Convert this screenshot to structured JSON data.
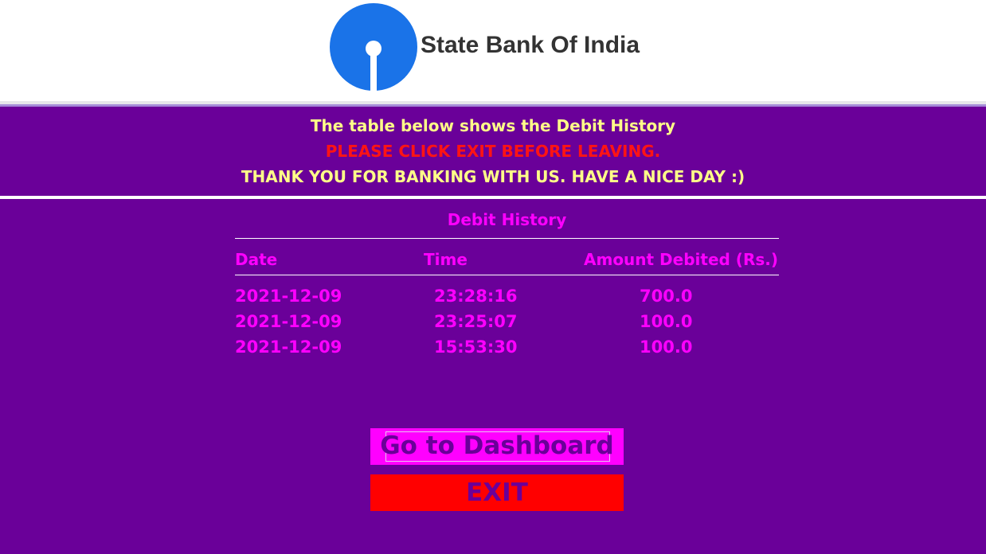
{
  "header": {
    "bank_name": "State Bank Of India",
    "logo_icon": "sbi-logo-icon",
    "logo_color": "#1a73e8"
  },
  "messages": {
    "info": "The table below shows the Debit History",
    "warning": "PLEASE CLICK EXIT BEFORE LEAVING.",
    "thanks": "THANK YOU FOR BANKING WITH US. HAVE A NICE DAY :)"
  },
  "table": {
    "title": "Debit History",
    "columns": [
      "Date",
      "Time",
      "Amount Debited (Rs.)"
    ],
    "rows": [
      [
        "2021-12-09",
        "23:28:16",
        "700.0"
      ],
      [
        "2021-12-09",
        "23:25:07",
        "100.0"
      ],
      [
        "2021-12-09",
        "15:53:30",
        "100.0"
      ]
    ]
  },
  "buttons": {
    "dashboard": "Go to Dashboard",
    "exit": "EXIT"
  },
  "colors": {
    "background": "#6a0099",
    "accent_magenta": "#ff00ff",
    "warning_red": "#ff1414",
    "message_yellow": "#ffff88",
    "exit_red": "#ff0000"
  }
}
